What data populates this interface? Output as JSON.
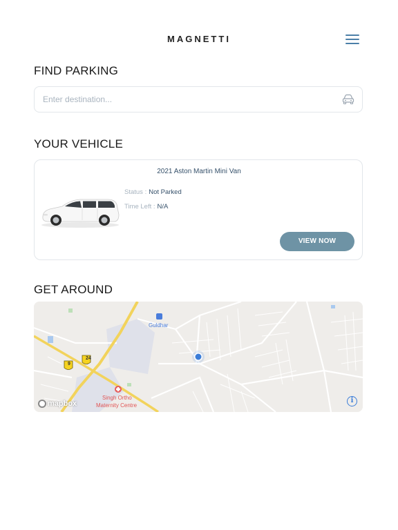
{
  "header": {
    "brand": "MAGNETTI",
    "menu_icon": "hamburger-menu-icon"
  },
  "find_parking": {
    "title": "FIND PARKING",
    "search_placeholder": "Enter destination...",
    "search_icon": "car-icon"
  },
  "vehicle": {
    "section_title": "YOUR VEHICLE",
    "name": "2021 Aston Martin  Mini Van",
    "status_label": "Status :",
    "status_value": "Not Parked",
    "time_label": "Time Left :",
    "time_value": "N/A",
    "button_label": "VIEW NOW",
    "button_color": "#6e93a5"
  },
  "get_around": {
    "title": "GET AROUND",
    "labels": {
      "guldhar": "Guldhar",
      "hospital": "Singh Ortho",
      "hospital2": "Maternity Centre",
      "road_badge_1": "9",
      "road_badge_2": "24",
      "attribution": "mapbox"
    },
    "location_dot_color": "#3b7dd8"
  }
}
